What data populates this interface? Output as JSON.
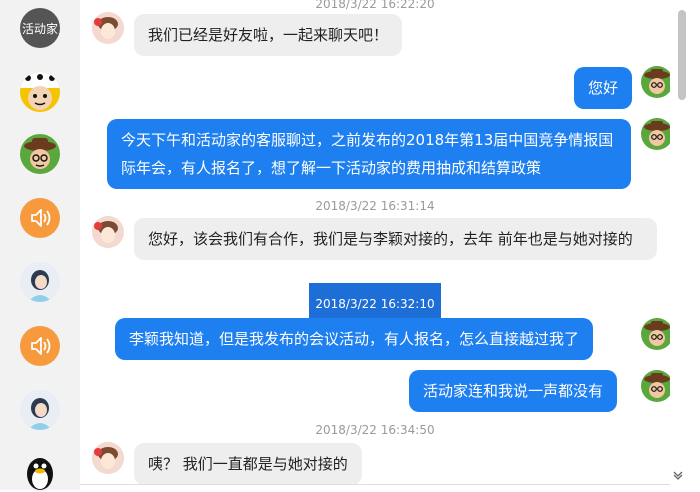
{
  "sidebar": {
    "items": [
      {
        "label": "活动家"
      }
    ]
  },
  "chat": {
    "timestamps": [
      "2018/3/22 16:22:20",
      "2018/3/22 16:31:14",
      "2018/3/22 16:32:10",
      "2018/3/22 16:34:50"
    ],
    "messages": [
      {
        "side": "left",
        "text": "我们已经是好友啦，一起来聊天吧！"
      },
      {
        "side": "right",
        "text": "您好"
      },
      {
        "side": "right",
        "text": "今天下午和活动家的客服聊过，之前发布的2018年第13届中国竞争情报国际年会，有人报名了，想了解一下活动家的费用抽成和结算政策"
      },
      {
        "side": "left",
        "text": "您好，该会我们有合作，我们是与李颖对接的，去年 前年也是与她对接的"
      },
      {
        "side": "right",
        "text": "李颖我知道，但是我发布的会议活动，有人报名，怎么直接越过我了"
      },
      {
        "side": "right",
        "text": "活动家连和我说一声都没有"
      },
      {
        "side": "left",
        "text": "咦？ 我们一直都是与她对接的"
      }
    ]
  },
  "colors": {
    "sent": "#1e7ff0",
    "received": "#eeeeee",
    "sidebar": "#f2f2f2",
    "selection": "#1e6ed8"
  },
  "icons": [
    "speaker-icon",
    "qq-penguin-icon",
    "collapse-chevron-icon"
  ]
}
